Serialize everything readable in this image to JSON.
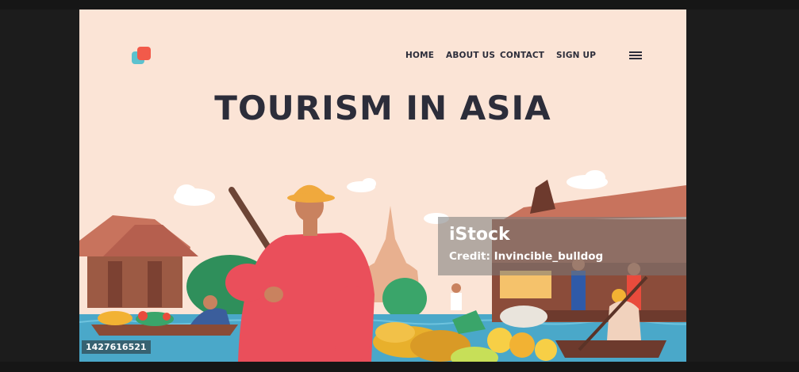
{
  "nav": {
    "home": "HOME",
    "about": "ABOUT US",
    "contact": "CONTACT",
    "signup": "SIGN UP"
  },
  "hero": {
    "title": "TOURISM IN ASIA"
  },
  "watermark": {
    "brand": "iStock",
    "credit": "Credit: Invincible_bulldog",
    "image_id": "1427616521"
  },
  "icons": {
    "logo": "logo-icon",
    "menu": "hamburger-menu-icon"
  },
  "colors": {
    "background": "#fbe4d6",
    "text": "#2c2d3a",
    "logo_red": "#f25a4a",
    "logo_teal": "#5cc2cf",
    "water": "#4aa8c9"
  }
}
